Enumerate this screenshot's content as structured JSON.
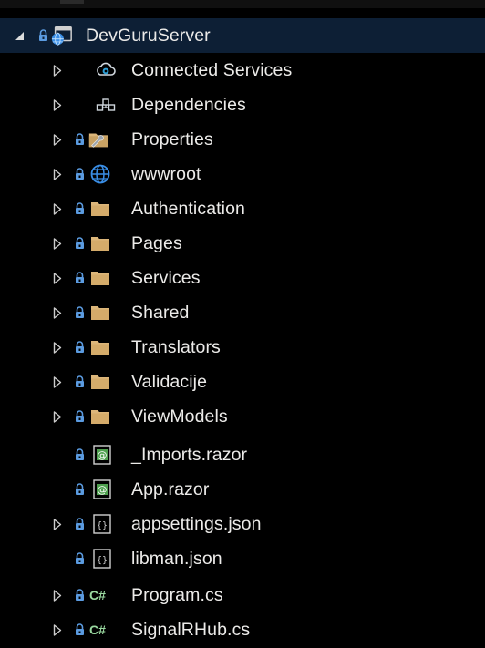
{
  "tree": {
    "project": "DevGuruServer",
    "items": [
      {
        "label": "Connected Services",
        "icon": "connected-services-icon",
        "locked": false
      },
      {
        "label": "Dependencies",
        "icon": "dependencies-icon",
        "locked": false
      },
      {
        "label": "Properties",
        "icon": "properties-icon",
        "locked": true
      },
      {
        "label": "wwwroot",
        "icon": "globe-icon",
        "locked": true
      },
      {
        "label": "Authentication",
        "icon": "folder-icon",
        "locked": true
      },
      {
        "label": "Pages",
        "icon": "folder-icon",
        "locked": true
      },
      {
        "label": "Services",
        "icon": "folder-icon",
        "locked": true
      },
      {
        "label": "Shared",
        "icon": "folder-icon",
        "locked": true
      },
      {
        "label": "Translators",
        "icon": "folder-icon",
        "locked": true
      },
      {
        "label": "Validacije",
        "icon": "folder-icon",
        "locked": true
      },
      {
        "label": "ViewModels",
        "icon": "folder-icon",
        "locked": true
      },
      {
        "label": "_Imports.razor",
        "icon": "razor-file-icon",
        "locked": true
      },
      {
        "label": "App.razor",
        "icon": "razor-file-icon",
        "locked": true
      },
      {
        "label": "appsettings.json",
        "icon": "json-file-icon",
        "locked": true
      },
      {
        "label": "libman.json",
        "icon": "json-file-icon",
        "locked": true
      },
      {
        "label": "Program.cs",
        "icon": "csharp-file-icon",
        "locked": true
      },
      {
        "label": "SignalRHub.cs",
        "icon": "csharp-file-icon",
        "locked": true
      }
    ],
    "csharp_glyph": "C#"
  },
  "colors": {
    "text": "#ECEBE9",
    "lock": "#5B9BE0",
    "folder": "#DCB67A",
    "csharp": "#9AD9A0",
    "razor": "#4EA04E",
    "globe": "#3A8EE6",
    "chevron": "#CCCCCC",
    "selected_row": "#0D1F35"
  }
}
